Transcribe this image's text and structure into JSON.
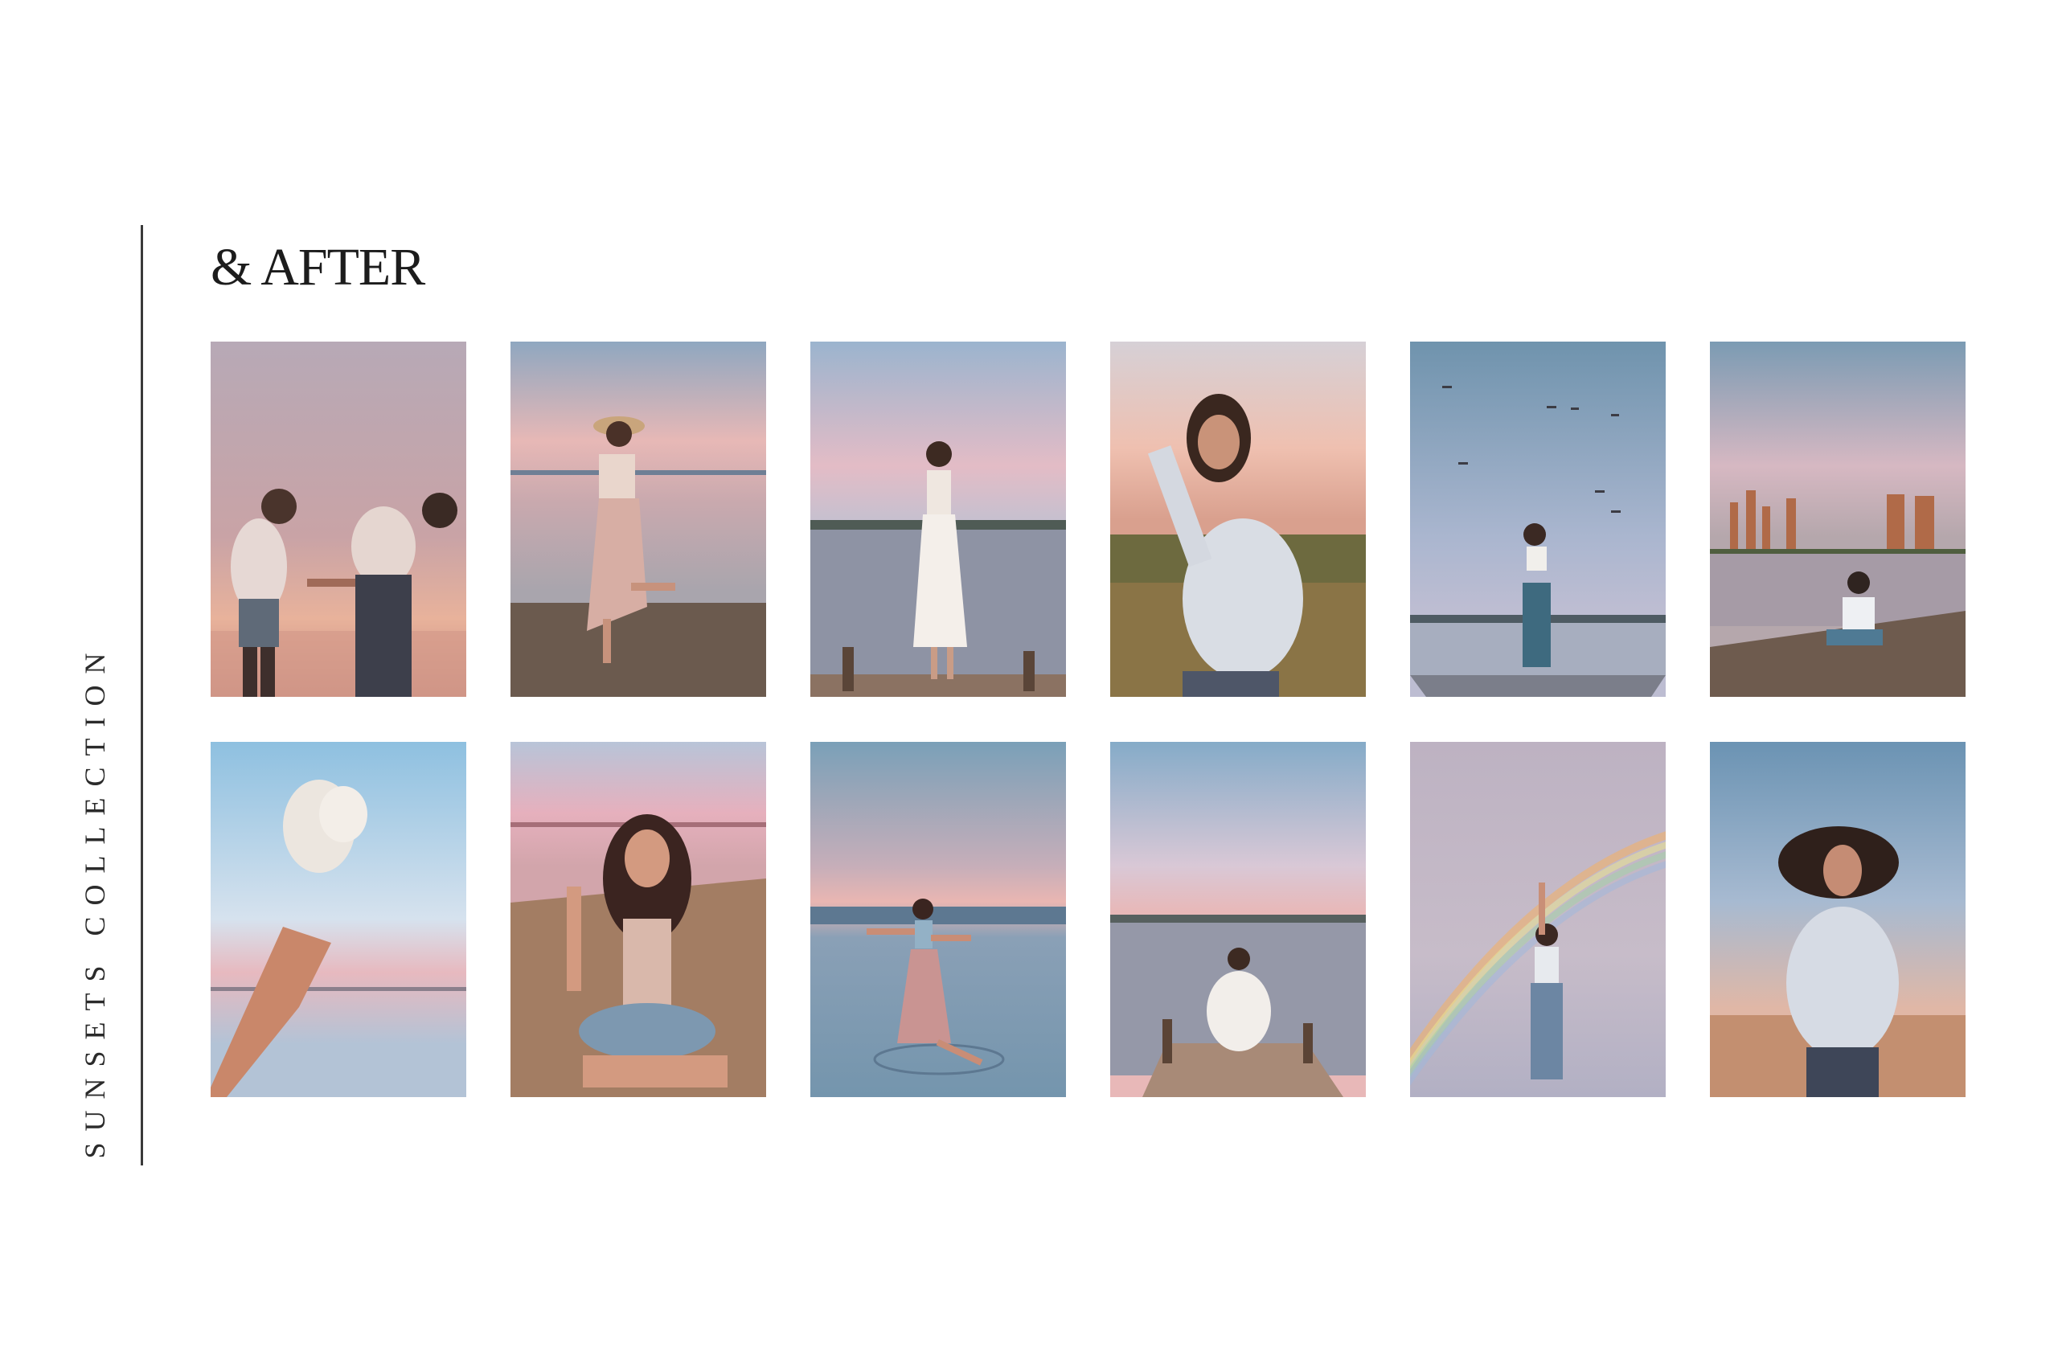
{
  "side_caption": "SUNSETS COLLECTION",
  "heading": "& AFTER",
  "photos": [
    {
      "row": 1,
      "depicts": "two people holding hands at sunset"
    },
    {
      "row": 1,
      "depicts": "woman in hat on beach"
    },
    {
      "row": 1,
      "depicts": "woman in white dress on dock"
    },
    {
      "row": 1,
      "depicts": "woman in white sweater in field"
    },
    {
      "row": 1,
      "depicts": "woman on pier with birds in sky"
    },
    {
      "row": 1,
      "depicts": "woman sitting on beach with city skyline"
    },
    {
      "row": 2,
      "depicts": "hand holding white flowers"
    },
    {
      "row": 2,
      "depicts": "woman sitting on sand"
    },
    {
      "row": 2,
      "depicts": "woman dancing in water"
    },
    {
      "row": 2,
      "depicts": "woman sitting at end of dock"
    },
    {
      "row": 2,
      "depicts": "woman jumping with rainbow"
    },
    {
      "row": 2,
      "depicts": "woman in sweater with hair blowing"
    }
  ],
  "colors": {
    "text": "#1c1c1c",
    "divider": "#3a3a3a",
    "sky_pink": "#e9b8b6",
    "sky_blue": "#8fb3cf",
    "water": "#a3aebd",
    "sand": "#6b5546"
  }
}
